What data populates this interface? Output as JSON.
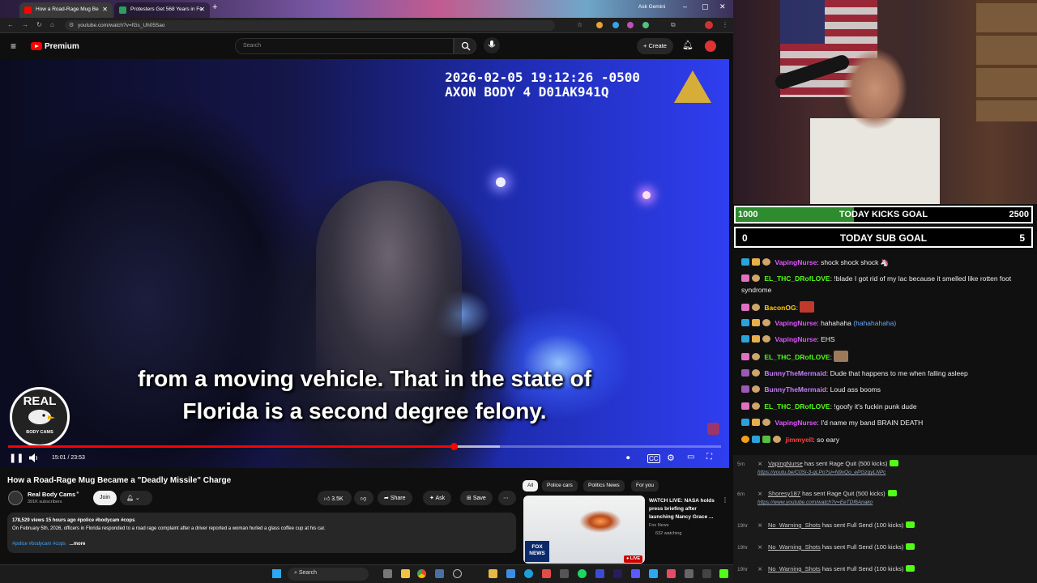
{
  "browser": {
    "tabs": [
      {
        "label": "How a Road-Rage Mug Be",
        "active": true
      },
      {
        "label": "Protesters Get 568 Years in Fe",
        "active": false
      }
    ],
    "ask_gemini": "Ask Gemini",
    "url": "youtube.com/watch?v=fGs_Uh05Sao"
  },
  "youtube": {
    "brand": "Premium",
    "search_placeholder": "Search",
    "create_label": "Create",
    "video": {
      "timestamp_line1": "2026-02-05 19:12:26 -0500",
      "timestamp_line2": "AXON BODY 4 D01AK941Q",
      "subtitle_line1": "from a moving vehicle. That in the state of",
      "subtitle_line2": "Florida is a second degree felony.",
      "badge_top": "REAL",
      "badge_bottom": "BODY CAMS",
      "time_display": "15:01 / 23:53",
      "progress_played": 0.625,
      "progress_buffered": 0.69
    },
    "title": "How a Road-Rage Mug Became a \"Deadly Missile\" Charge",
    "channel": {
      "name": "Real Body Cams",
      "subscribers": "391K subscribers",
      "join_label": "Join"
    },
    "actions": {
      "likes": "3.5K",
      "share": "Share",
      "ask": "Ask",
      "save": "Save"
    },
    "description": {
      "meta": "178,529 views  15 hours ago  #police #bodycam #cops",
      "text": "On February 5th, 2026, officers in Florida responded to a road rage complaint after a driver reported a woman hurled a glass coffee cup at his car.",
      "tags": "#police #bodycam #cops",
      "more": "...more"
    },
    "chips": [
      "All",
      "Police cars",
      "Politics News",
      "For you"
    ],
    "recommended": {
      "title": "WATCH LIVE: NASA holds press briefing after launching Nancy Grace ...",
      "channel": "Fox News",
      "watching": "632 watching",
      "live_badge": "LIVE",
      "logo_text": "FOX NEWS"
    }
  },
  "taskbar": {
    "search_label": "Search"
  },
  "stream": {
    "kicks_goal": {
      "current": "1000",
      "label": "TODAY KICKS GOAL",
      "target": "2500",
      "fraction": 0.4
    },
    "sub_goal": {
      "current": "0",
      "label": "TODAY SUB GOAL",
      "target": "5"
    },
    "chat": [
      {
        "user": "VapingNurse",
        "color": "#e056fd",
        "text": "shock shock shock 🦄"
      },
      {
        "user": "EL_THC_DRofLOVE",
        "color": "#53fc18",
        "text": "!blade I got rid of my lac because it smelled like rotten foot syndrome"
      },
      {
        "user": "BaconOG",
        "color": "#ffcc00",
        "text": ""
      },
      {
        "user": "VapingNurse",
        "color": "#e056fd",
        "text": "hahahaha",
        "text2": "(hahahahaha)"
      },
      {
        "user": "VapingNurse",
        "color": "#e056fd",
        "text": "EHS"
      },
      {
        "user": "EL_THC_DRofLOVE",
        "color": "#53fc18",
        "text": ""
      },
      {
        "user": "BunnyTheMermaid",
        "color": "#c77dff",
        "text": "Dude that happens to me when falling asleep"
      },
      {
        "user": "BunnyTheMermaid",
        "color": "#c77dff",
        "text": "Loud ass booms"
      },
      {
        "user": "EL_THC_DRofLOVE",
        "color": "#53fc18",
        "text": "!goofy it's fuckin punk dude"
      },
      {
        "user": "VapingNurse",
        "color": "#e056fd",
        "text": "I'd name my band BRAIN DEATH"
      },
      {
        "user": "jimmyell",
        "color": "#ff4040",
        "text": "so eary"
      }
    ],
    "events": [
      {
        "time": "5m",
        "user": "VapingNurse",
        "action": "has sent Rage Quit (500 kicks)",
        "link": "https://youtu.be/C0Si-3-gLPo?si=N9vQo_ePGzqyLNPc"
      },
      {
        "time": "6m",
        "user": "Shoresy187",
        "action": "has sent Rage Quit (500 kicks)",
        "link": "https://www.youtube.com/watch?v=EeTDf6Anako"
      },
      {
        "time": "19hr",
        "user": "No_Warning_Shots",
        "action": "has sent Full Send (100 kicks)",
        "link": ""
      },
      {
        "time": "19hr",
        "user": "No_Warning_Shots",
        "action": "has sent Full Send (100 kicks)",
        "link": ""
      },
      {
        "time": "19hr",
        "user": "No_Warning_Shots",
        "action": "has sent Full Send (100 kicks)",
        "link": ""
      }
    ]
  }
}
